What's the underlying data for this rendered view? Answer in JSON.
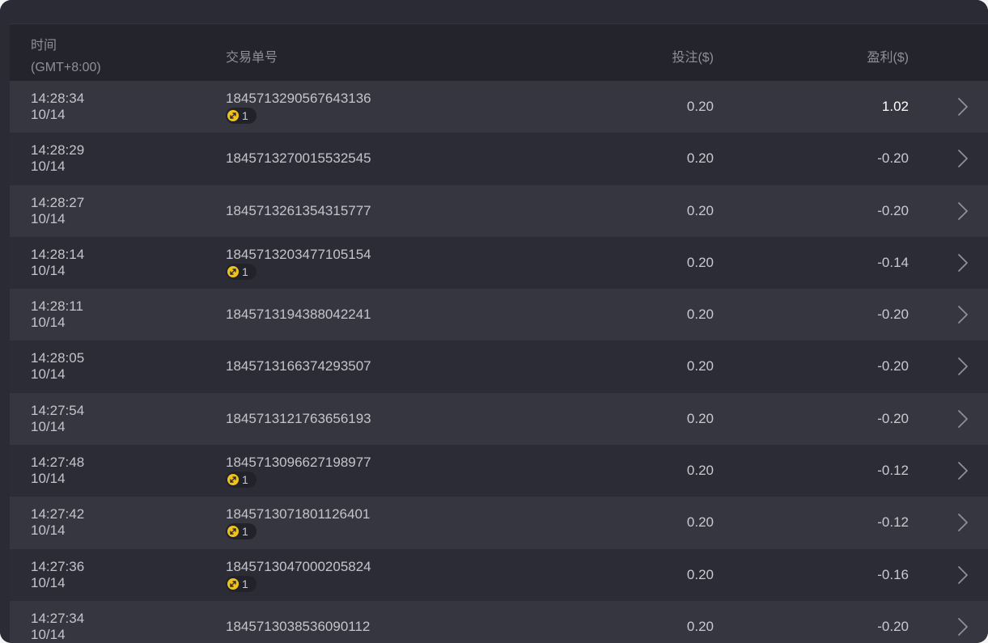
{
  "header": {
    "time_label": "时间",
    "timezone_label": "(GMT+8:00)",
    "id_label": "交易单号",
    "bet_label": "投注($)",
    "profit_label": "盈利($)"
  },
  "rows": [
    {
      "time": "14:28:34",
      "date": "10/14",
      "id": "1845713290567643136",
      "badge": "1",
      "bet": "0.20",
      "profit": "1.02"
    },
    {
      "time": "14:28:29",
      "date": "10/14",
      "id": "1845713270015532545",
      "badge": "",
      "bet": "0.20",
      "profit": "-0.20"
    },
    {
      "time": "14:28:27",
      "date": "10/14",
      "id": "1845713261354315777",
      "badge": "",
      "bet": "0.20",
      "profit": "-0.20"
    },
    {
      "time": "14:28:14",
      "date": "10/14",
      "id": "1845713203477105154",
      "badge": "1",
      "bet": "0.20",
      "profit": "-0.14"
    },
    {
      "time": "14:28:11",
      "date": "10/14",
      "id": "1845713194388042241",
      "badge": "",
      "bet": "0.20",
      "profit": "-0.20"
    },
    {
      "time": "14:28:05",
      "date": "10/14",
      "id": "1845713166374293507",
      "badge": "",
      "bet": "0.20",
      "profit": "-0.20"
    },
    {
      "time": "14:27:54",
      "date": "10/14",
      "id": "1845713121763656193",
      "badge": "",
      "bet": "0.20",
      "profit": "-0.20"
    },
    {
      "time": "14:27:48",
      "date": "10/14",
      "id": "1845713096627198977",
      "badge": "1",
      "bet": "0.20",
      "profit": "-0.12"
    },
    {
      "time": "14:27:42",
      "date": "10/14",
      "id": "1845713071801126401",
      "badge": "1",
      "bet": "0.20",
      "profit": "-0.12"
    },
    {
      "time": "14:27:36",
      "date": "10/14",
      "id": "1845713047000205824",
      "badge": "1",
      "bet": "0.20",
      "profit": "-0.16"
    },
    {
      "time": "14:27:34",
      "date": "10/14",
      "id": "1845713038536090112",
      "badge": "",
      "bet": "0.20",
      "profit": "-0.20"
    }
  ],
  "icons": {
    "badge_icon": "coin-icon",
    "row_arrow": "chevron-right-icon"
  },
  "colors": {
    "panel_bg": "#2b2b35",
    "header_bg": "#24242c",
    "row_odd": "#363640",
    "row_even": "#2c2c36",
    "coin": "#f1c21b"
  }
}
